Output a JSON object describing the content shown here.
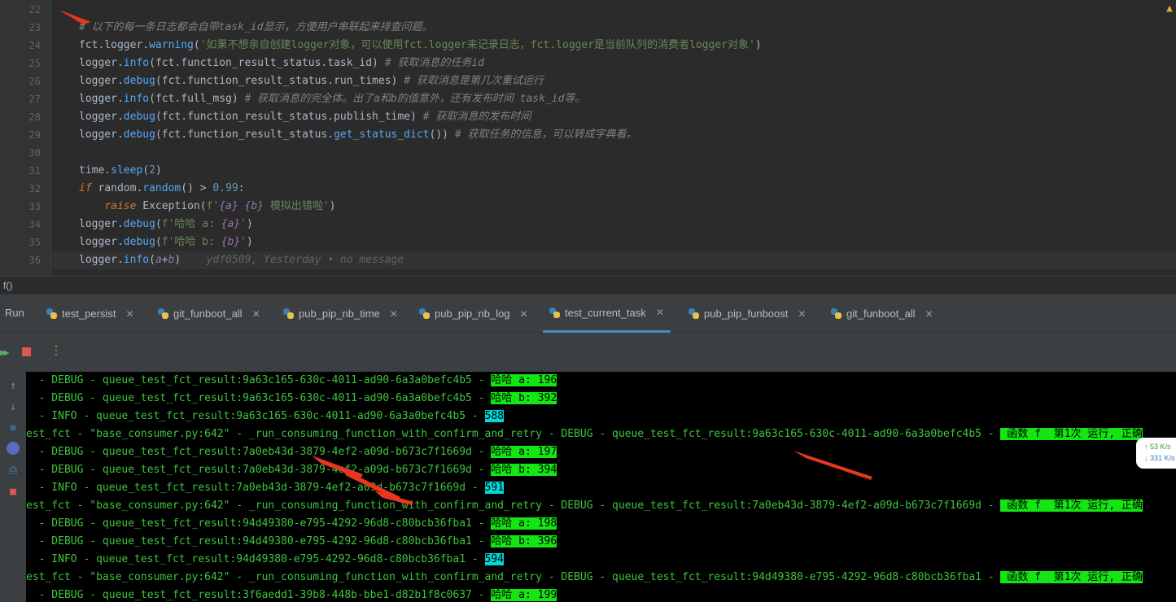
{
  "editor": {
    "lines": [
      {
        "num": "22",
        "parts": []
      },
      {
        "num": "23",
        "parts": [
          {
            "t": "# 以下的每一条日志都会自带task_id显示，方便用户串联起来排查问题。",
            "c": "c-com"
          }
        ]
      },
      {
        "num": "24",
        "parts": [
          {
            "t": "fct.logger.",
            "c": ""
          },
          {
            "t": "warning",
            "c": "c-fn"
          },
          {
            "t": "(",
            "c": ""
          },
          {
            "t": "'如果不想亲自创建logger对象，可以使用fct.logger来记录日志，fct.logger是当前队列的消费者logger对象'",
            "c": "c-str"
          },
          {
            "t": ")",
            "c": ""
          }
        ]
      },
      {
        "num": "25",
        "parts": [
          {
            "t": "logger.",
            "c": ""
          },
          {
            "t": "info",
            "c": "c-fn"
          },
          {
            "t": "(fct.function_result_status.task_id) ",
            "c": ""
          },
          {
            "t": "# 获取消息的任务id",
            "c": "c-com"
          }
        ]
      },
      {
        "num": "26",
        "parts": [
          {
            "t": "logger.",
            "c": ""
          },
          {
            "t": "debug",
            "c": "c-fn"
          },
          {
            "t": "(fct.function_result_status.run_times) ",
            "c": ""
          },
          {
            "t": "# 获取消息是第几次重试运行",
            "c": "c-com"
          }
        ]
      },
      {
        "num": "27",
        "parts": [
          {
            "t": "logger.",
            "c": ""
          },
          {
            "t": "info",
            "c": "c-fn"
          },
          {
            "t": "(fct.full_msg) ",
            "c": ""
          },
          {
            "t": "# 获取消息的完全体。出了a和b的值意外，还有发布时间 task_id等。",
            "c": "c-com"
          }
        ]
      },
      {
        "num": "28",
        "parts": [
          {
            "t": "logger.",
            "c": ""
          },
          {
            "t": "debug",
            "c": "c-fn"
          },
          {
            "t": "(fct.function_result_status.publish_time) ",
            "c": ""
          },
          {
            "t": "# 获取消息的发布时间",
            "c": "c-com"
          }
        ]
      },
      {
        "num": "29",
        "parts": [
          {
            "t": "logger.",
            "c": ""
          },
          {
            "t": "debug",
            "c": "c-fn"
          },
          {
            "t": "(fct.function_result_status.",
            "c": ""
          },
          {
            "t": "get_status_dict",
            "c": "c-fn"
          },
          {
            "t": "()) ",
            "c": ""
          },
          {
            "t": "# 获取任务的信息，可以转成字典看。",
            "c": "c-com"
          }
        ]
      },
      {
        "num": "30",
        "parts": []
      },
      {
        "num": "31",
        "parts": [
          {
            "t": "time.",
            "c": ""
          },
          {
            "t": "sleep",
            "c": "c-fn"
          },
          {
            "t": "(",
            "c": ""
          },
          {
            "t": "2",
            "c": "c-num"
          },
          {
            "t": ")",
            "c": ""
          }
        ]
      },
      {
        "num": "32",
        "parts": [
          {
            "t": "if ",
            "c": "c-kw"
          },
          {
            "t": "random.",
            "c": ""
          },
          {
            "t": "random",
            "c": "c-fn"
          },
          {
            "t": "() > ",
            "c": ""
          },
          {
            "t": "0.99",
            "c": "c-num"
          },
          {
            "t": ":",
            "c": ""
          }
        ]
      },
      {
        "num": "33",
        "parts": [
          {
            "t": "    ",
            "c": ""
          },
          {
            "t": "raise ",
            "c": "c-kw"
          },
          {
            "t": "Exception(",
            "c": ""
          },
          {
            "t": "f'",
            "c": "c-str"
          },
          {
            "t": "{a}",
            "c": "c-fvar"
          },
          {
            "t": " ",
            "c": "c-str"
          },
          {
            "t": "{b}",
            "c": "c-fvar"
          },
          {
            "t": " 模拟出错啦'",
            "c": "c-str"
          },
          {
            "t": ")",
            "c": ""
          }
        ]
      },
      {
        "num": "34",
        "parts": [
          {
            "t": "logger.",
            "c": ""
          },
          {
            "t": "debug",
            "c": "c-fn"
          },
          {
            "t": "(",
            "c": ""
          },
          {
            "t": "f'哈哈 a: ",
            "c": "c-str"
          },
          {
            "t": "{a}",
            "c": "c-fvar"
          },
          {
            "t": "'",
            "c": "c-str"
          },
          {
            "t": ")",
            "c": ""
          }
        ]
      },
      {
        "num": "35",
        "parts": [
          {
            "t": "logger.",
            "c": ""
          },
          {
            "t": "debug",
            "c": "c-fn"
          },
          {
            "t": "(",
            "c": ""
          },
          {
            "t": "f'哈哈 b: ",
            "c": "c-str"
          },
          {
            "t": "{b}",
            "c": "c-fvar"
          },
          {
            "t": "'",
            "c": "c-str"
          },
          {
            "t": ")",
            "c": ""
          }
        ]
      },
      {
        "num": "36",
        "parts": [
          {
            "t": "logger.",
            "c": ""
          },
          {
            "t": "info",
            "c": "c-fn"
          },
          {
            "t": "(",
            "c": ""
          },
          {
            "t": "a",
            "c": "c-fvar"
          },
          {
            "t": "+",
            "c": ""
          },
          {
            "t": "b",
            "c": "c-fvar"
          },
          {
            "t": ")",
            "c": ""
          },
          {
            "t": "    ydf0509, Yesterday • no message",
            "c": "c-blame"
          }
        ]
      }
    ]
  },
  "breadcrumb": "f()",
  "run_panel": {
    "label": "Run",
    "tabs": [
      {
        "label": "test_persist",
        "active": false
      },
      {
        "label": "git_funboot_all",
        "active": false
      },
      {
        "label": "pub_pip_nb_time",
        "active": false
      },
      {
        "label": "pub_pip_nb_log",
        "active": false
      },
      {
        "label": "test_current_task",
        "active": true
      },
      {
        "label": "pub_pip_funboost",
        "active": false
      },
      {
        "label": "git_funboot_all",
        "active": false
      }
    ]
  },
  "console": {
    "lines": [
      {
        "text": "  - DEBUG - queue_test_fct_result:9a63c165-630c-4011-ad90-6a3a0befc4b5 - ",
        "hl": "哈哈 a: 196",
        "hlc": "g"
      },
      {
        "text": "  - DEBUG - queue_test_fct_result:9a63c165-630c-4011-ad90-6a3a0befc4b5 - ",
        "hl": "哈哈 b: 392",
        "hlc": "g"
      },
      {
        "text": "  - INFO - queue_test_fct_result:9a63c165-630c-4011-ad90-6a3a0befc4b5 - ",
        "hl": "588",
        "hlc": "c"
      },
      {
        "text": "est_fct - \"base_consumer.py:642\" - _run_consuming_function_with_confirm_and_retry - DEBUG - queue_test_fct_result:9a63c165-630c-4011-ad90-6a3a0befc4b5 - ",
        "hl": " 函数 f  第1次 运行, 正确",
        "hlc": "g"
      },
      {
        "text": "  - DEBUG - queue_test_fct_result:7a0eb43d-3879-4ef2-a09d-b673c7f1669d - ",
        "hl": "哈哈 a: 197",
        "hlc": "g"
      },
      {
        "text": "  - DEBUG - queue_test_fct_result:7a0eb43d-3879-4ef2-a09d-b673c7f1669d - ",
        "hl": "哈哈 b: 394",
        "hlc": "g"
      },
      {
        "text": "  - INFO - queue_test_fct_result:7a0eb43d-3879-4ef2-a09d-b673c7f1669d - ",
        "hl": "591",
        "hlc": "c"
      },
      {
        "text": "est_fct - \"base_consumer.py:642\" - _run_consuming_function_with_confirm_and_retry - DEBUG - queue_test_fct_result:7a0eb43d-3879-4ef2-a09d-b673c7f1669d - ",
        "hl": " 函数 f  第1次 运行, 正确",
        "hlc": "g"
      },
      {
        "text": "  - DEBUG - queue_test_fct_result:94d49380-e795-4292-96d8-c80bcb36fba1 - ",
        "hl": "哈哈 a: 198",
        "hlc": "g"
      },
      {
        "text": "  - DEBUG - queue_test_fct_result:94d49380-e795-4292-96d8-c80bcb36fba1 - ",
        "hl": "哈哈 b: 396",
        "hlc": "g"
      },
      {
        "text": "  - INFO - queue_test_fct_result:94d49380-e795-4292-96d8-c80bcb36fba1 - ",
        "hl": "594",
        "hlc": "c"
      },
      {
        "text": "est_fct - \"base_consumer.py:642\" - _run_consuming_function_with_confirm_and_retry - DEBUG - queue_test_fct_result:94d49380-e795-4292-96d8-c80bcb36fba1 - ",
        "hl": " 函数 f  第1次 运行, 正确",
        "hlc": "g"
      },
      {
        "text": "  - DEBUG - queue_test_fct_result:3f6aedd1-39b8-448b-bbe1-d82b1f8c0637 - ",
        "hl": "哈哈 a: 199",
        "hlc": "g"
      }
    ]
  },
  "net_widget": {
    "up": "↑ 53  K/s",
    "down": "↓ 331 K/s"
  },
  "colors": {
    "accent": "#4a88c7",
    "console_text": "#3ec43e",
    "highlight_green": "#13e613",
    "highlight_cyan": "#00d7d7",
    "arrow": "#e8361f"
  }
}
